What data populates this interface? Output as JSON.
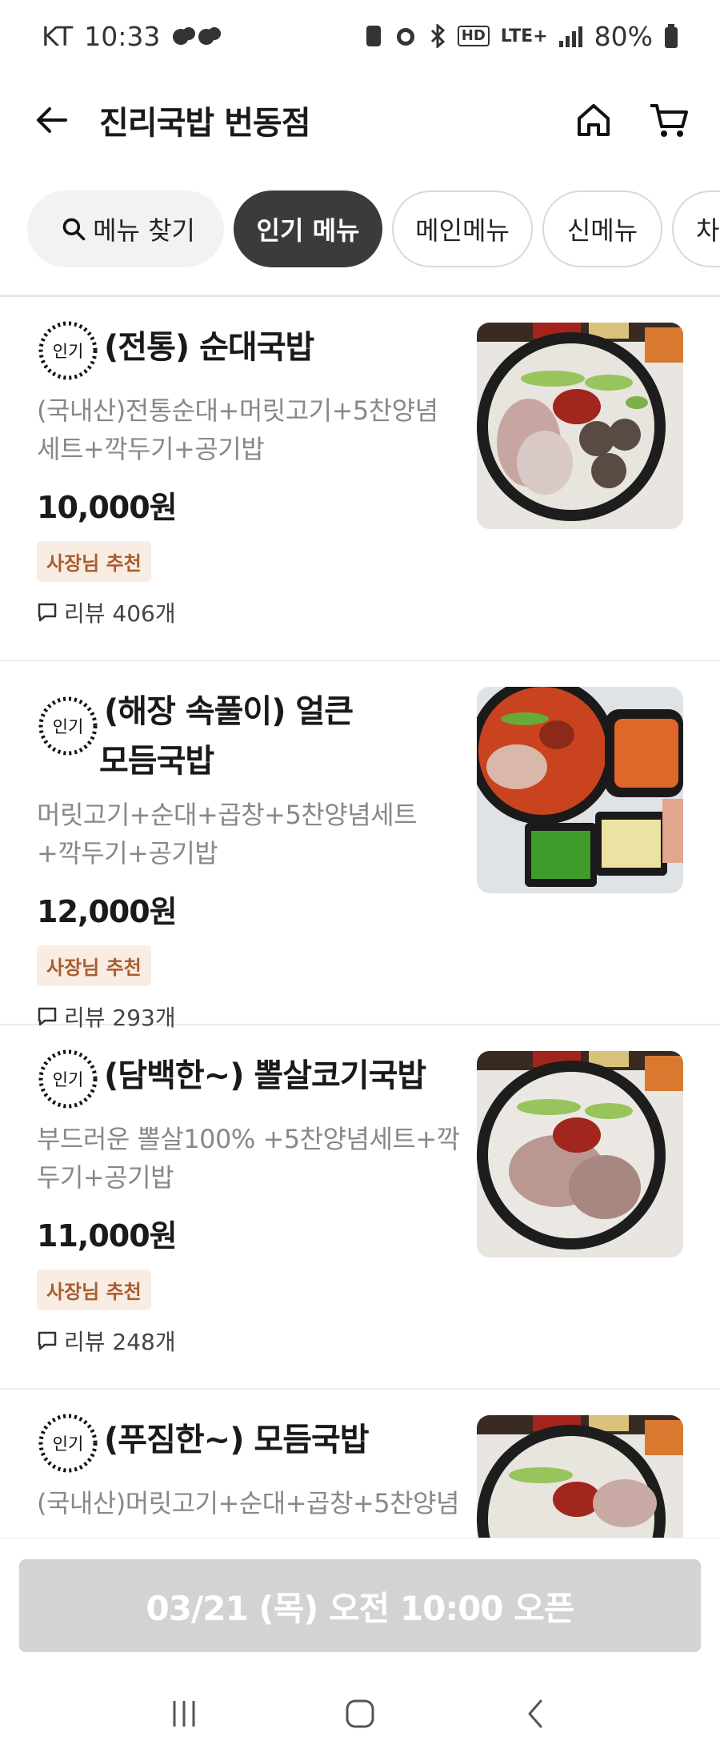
{
  "status_bar": {
    "carrier": "KT",
    "time": "10:33",
    "network": "LTE+",
    "battery": "80%"
  },
  "header": {
    "title": "진리국밥 번동점"
  },
  "chips": {
    "search_label": "메뉴 찾기",
    "items": [
      "인기 메뉴",
      "메인메뉴",
      "신메뉴",
      "차"
    ]
  },
  "menu_items": [
    {
      "badge": "인기",
      "name_line1": "(전통) 순대국밥",
      "name_line2": "",
      "desc": "(국내산)전통순대+머릿고기+5찬양념세트+깍두기+공기밥",
      "price": "10,000원",
      "recommend": "사장님 추천",
      "reviews": "리뷰 406개"
    },
    {
      "badge": "인기",
      "name_line1": "(해장 속풀이) 얼큰",
      "name_line2": "모듬국밥",
      "desc": "머릿고기+순대+곱창+5찬양념세트+깍두기+공기밥",
      "price": "12,000원",
      "recommend": "사장님 추천",
      "reviews": "리뷰 293개"
    },
    {
      "badge": "인기",
      "name_line1": "(담백한~) 뽈살코기국밥",
      "name_line2": "",
      "desc": "부드러운 뽈살100% +5찬양념세트+깍두기+공기밥",
      "price": "11,000원",
      "recommend": "사장님 추천",
      "reviews": "리뷰 248개"
    },
    {
      "badge": "인기",
      "name_line1": "(푸짐한~) 모듬국밥",
      "name_line2": "",
      "desc": "(국내산)머릿고기+순대+곱창+5찬양념",
      "price": "",
      "recommend": "",
      "reviews": ""
    }
  ],
  "open_button": "03/21 (목) 오전 10:00 오픈",
  "colors": {
    "accent_dark": "#3b3b3b",
    "recommend_bg": "#f8ece3",
    "recommend_text": "#a85d2f",
    "disabled_button": "#d3d3d3"
  },
  "icons": [
    "back-arrow-icon",
    "home-icon",
    "cart-icon",
    "search-icon",
    "review-bubble-icon",
    "popular-badge-icon",
    "recent-apps-icon",
    "home-nav-icon",
    "back-nav-icon"
  ]
}
